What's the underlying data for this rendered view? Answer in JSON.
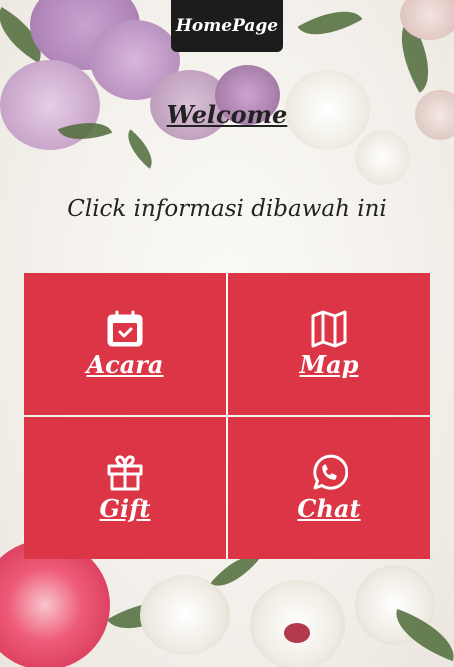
{
  "header": {
    "home_label": "HomePage"
  },
  "hero": {
    "welcome": "Welcome",
    "subtitle": "Click informasi dibawah ini"
  },
  "menu": {
    "items": [
      {
        "label": "Acara",
        "icon": "calendar-check-icon"
      },
      {
        "label": "Map",
        "icon": "map-icon"
      },
      {
        "label": "Gift",
        "icon": "gift-icon"
      },
      {
        "label": "Chat",
        "icon": "whatsapp-icon"
      }
    ]
  },
  "colors": {
    "tile": "#dc3545",
    "home_button": "#1c1c1c",
    "text": "#222222"
  }
}
